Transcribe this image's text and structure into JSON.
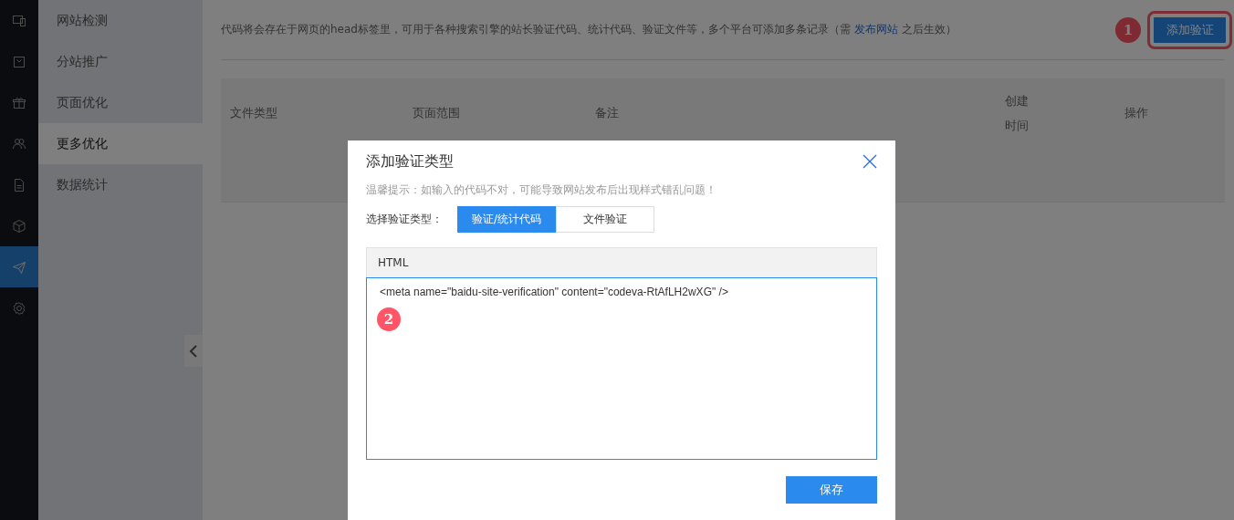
{
  "rail_items": [
    {
      "selected": false
    },
    {
      "selected": false
    },
    {
      "selected": false
    },
    {
      "selected": false
    },
    {
      "selected": false
    },
    {
      "selected": false
    },
    {
      "selected": true
    },
    {
      "selected": false
    }
  ],
  "sidebar": {
    "items": [
      {
        "label": "网站检测",
        "selected": false
      },
      {
        "label": "分站推广",
        "selected": false
      },
      {
        "label": "页面优化",
        "selected": false
      },
      {
        "label": "更多优化",
        "selected": true
      },
      {
        "label": "数据统计",
        "selected": false
      }
    ]
  },
  "notice": {
    "before": "代码将会存在于网页的head标签里，可用于各种搜索引擎的站长验证代码、统计代码、验证文件等，多个平台可添加多条记录（需",
    "link": "发布网站",
    "after": "之后生效）"
  },
  "add_button": {
    "label": "添加验证",
    "highlighted": true,
    "step_badge": "1"
  },
  "table": {
    "columns": [
      "文件类型",
      "页面范围",
      "备注",
      "创建时间",
      "操作"
    ]
  },
  "dialog": {
    "title": "添加验证类型",
    "hint": "温馨提示：如输入的代码不对，可能导致网站发布后出现样式错乱问题！",
    "type_label": "选择验证类型：",
    "type_options": [
      {
        "label": "验证/统计代码",
        "selected": true
      },
      {
        "label": "文件验证",
        "selected": false
      }
    ],
    "editor_header": "HTML",
    "editor_value": "<meta name=\"baidu-site-verification\" content=\"codeva-RtAfLH2wXG\" />",
    "step_badge": "2",
    "save_button": "保存"
  }
}
